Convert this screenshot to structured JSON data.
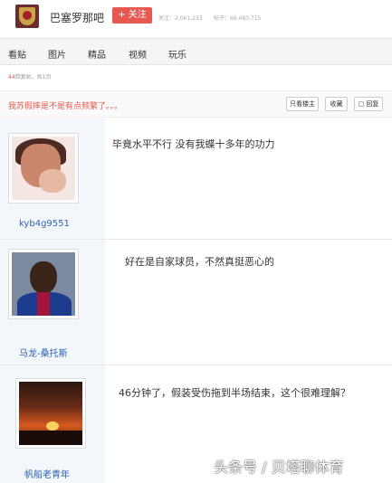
{
  "header": {
    "forum_name": "巴塞罗那吧",
    "follow_label": "+ 关注",
    "followers_text": "关注：2,061,233",
    "posts_text": "帖子：66,483,715"
  },
  "nav": {
    "tabs": [
      "看贴",
      "图片",
      "精品",
      "视频",
      "玩乐"
    ]
  },
  "meta": {
    "reply_count": "44",
    "reply_suffix": "回复贴，共1页"
  },
  "thread": {
    "title": "我苏假摔是不是有点频繁了。。。",
    "only_author_label": "只看楼主",
    "favorite_label": "收藏",
    "reply_label": "回复"
  },
  "posts": [
    {
      "username": "kyb4g9551",
      "text": "毕竟水平不行 没有我蝶十多年的功力",
      "avatar": "portrait-avatar"
    },
    {
      "username": "马龙-桑托斯",
      "text": "好在是自家球员，不然真挺恶心的",
      "avatar": "footballer-avatar"
    },
    {
      "username": "帆船老青年",
      "text": "46分钟了，假装受伤拖到半场结束，这个很难理解？",
      "avatar": "sunset-avatar"
    }
  ],
  "watermark": "头条号 / 贝塔聊体育",
  "colors": {
    "accent": "#e85850",
    "username": "#2d64b3",
    "sidebar_bg": "#f3f6fb"
  }
}
